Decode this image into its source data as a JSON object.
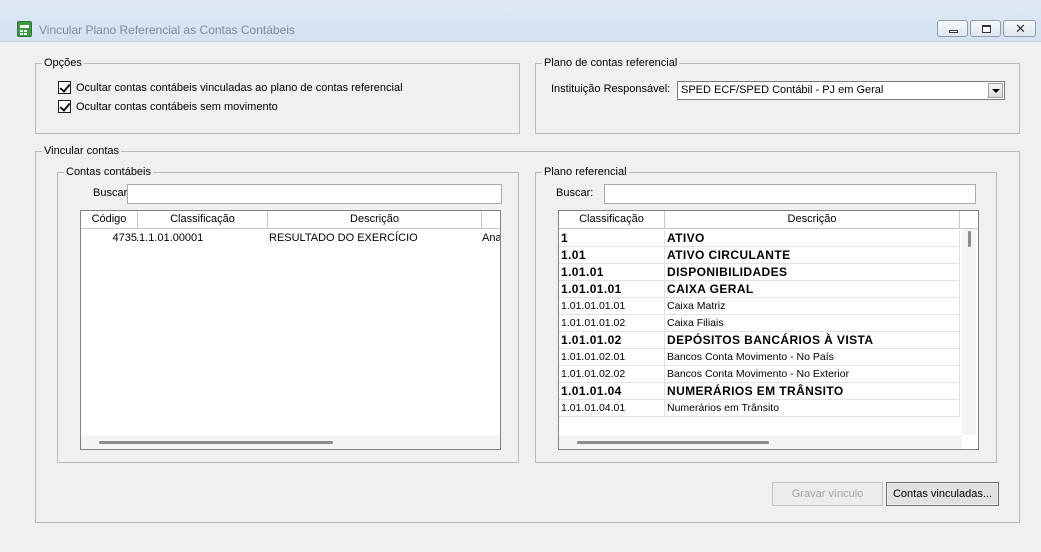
{
  "window": {
    "title": "Vincular Plano Referencial as Contas Contábeis"
  },
  "opcoes": {
    "label": "Opções",
    "check1": "Ocultar contas contábeis vinculadas ao plano de contas referencial",
    "check2": "Ocultar contas contábeis sem movimento"
  },
  "plano_contas": {
    "label": "Plano de contas referencial",
    "instituicao_label": "Instituição Responsável:",
    "instituicao_value": "SPED ECF/SPED Contábil - PJ em Geral"
  },
  "vincular": {
    "label": "Vincular contas"
  },
  "contas_contabeis": {
    "label": "Contas contábeis",
    "buscar_label": "Buscar:",
    "buscar_value": "",
    "columns": [
      "Código",
      "Classificação",
      "Descrição"
    ],
    "rows": [
      {
        "codigo": "4735",
        "classificacao": ".1.1.01.00001",
        "descricao": "RESULTADO DO EXERCÍCIO",
        "extra": "Ana"
      }
    ]
  },
  "plano_referencial": {
    "label": "Plano referencial",
    "buscar_label": "Buscar:",
    "buscar_value": "",
    "columns": [
      "Classificação",
      "Descrição"
    ],
    "rows": [
      {
        "classificacao": "1",
        "descricao": "ATIVO",
        "bold": true
      },
      {
        "classificacao": "1.01",
        "descricao": "ATIVO CIRCULANTE",
        "bold": true
      },
      {
        "classificacao": "1.01.01",
        "descricao": "DISPONIBILIDADES",
        "bold": true
      },
      {
        "classificacao": "1.01.01.01",
        "descricao": "CAIXA GERAL",
        "bold": true
      },
      {
        "classificacao": "1.01.01.01.01",
        "descricao": "Caixa Matriz",
        "bold": false
      },
      {
        "classificacao": "1.01.01.01.02",
        "descricao": "Caixa Filiais",
        "bold": false
      },
      {
        "classificacao": "1.01.01.02",
        "descricao": "DEPÓSITOS BANCÁRIOS À VISTA",
        "bold": true
      },
      {
        "classificacao": "1.01.01.02.01",
        "descricao": "Bancos Conta Movimento - No País",
        "bold": false
      },
      {
        "classificacao": "1.01.01.02.02",
        "descricao": "Bancos Conta Movimento - No Exterior",
        "bold": false
      },
      {
        "classificacao": "1.01.01.04",
        "descricao": "NUMERÁRIOS EM TRÂNSITO",
        "bold": true
      },
      {
        "classificacao": "1.01.01.04.01",
        "descricao": "Numerários em Trânsito",
        "bold": false
      }
    ]
  },
  "buttons": {
    "gravar": "Gravar vínculo",
    "contas_vinculadas": "Contas vinculadas..."
  }
}
